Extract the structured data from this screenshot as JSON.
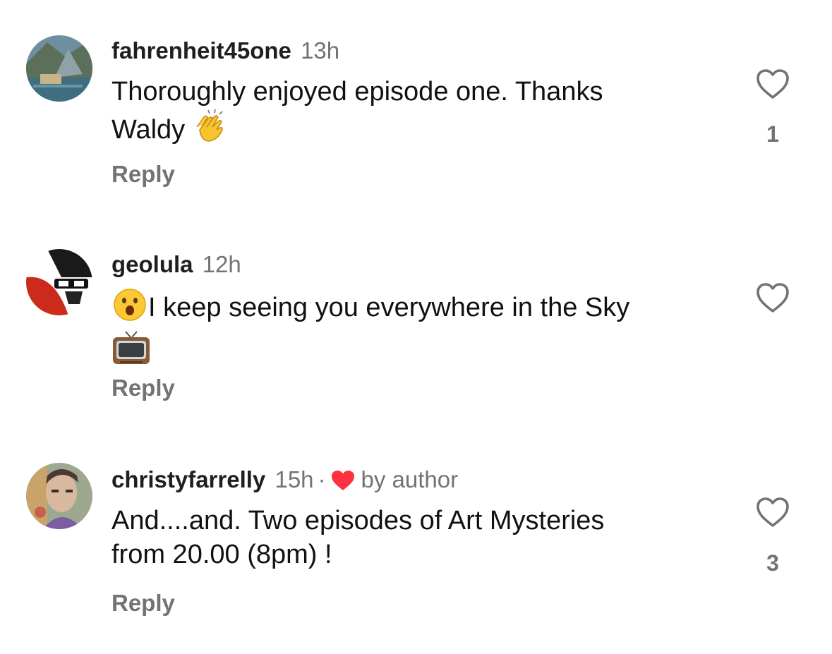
{
  "comments": [
    {
      "username": "fahrenheit45one",
      "time": "13h",
      "text_line1": "Thoroughly enjoyed episode one. Thanks",
      "text_line2": "Waldy",
      "emoji": "clapping-hands",
      "reply_label": "Reply",
      "likes": "1",
      "liked_by_author": false
    },
    {
      "username": "geolula",
      "time": "12h",
      "emoji_lead": "hushed-face",
      "text_line1": "I keep seeing you everywhere in the Sky",
      "emoji_trail": "television",
      "reply_label": "Reply",
      "likes": "",
      "liked_by_author": false
    },
    {
      "username": "christyfarrelly",
      "time": "15h",
      "separator": "·",
      "author_badge": "by author",
      "text_line1": "And....and. Two episodes of Art Mysteries",
      "text_line2": "from 20.00 (8pm) !",
      "reply_label": "Reply",
      "likes": "3",
      "liked_by_author": true
    }
  ],
  "colors": {
    "muted": "#737373",
    "heart_red": "#ff3040",
    "text": "#111111"
  }
}
